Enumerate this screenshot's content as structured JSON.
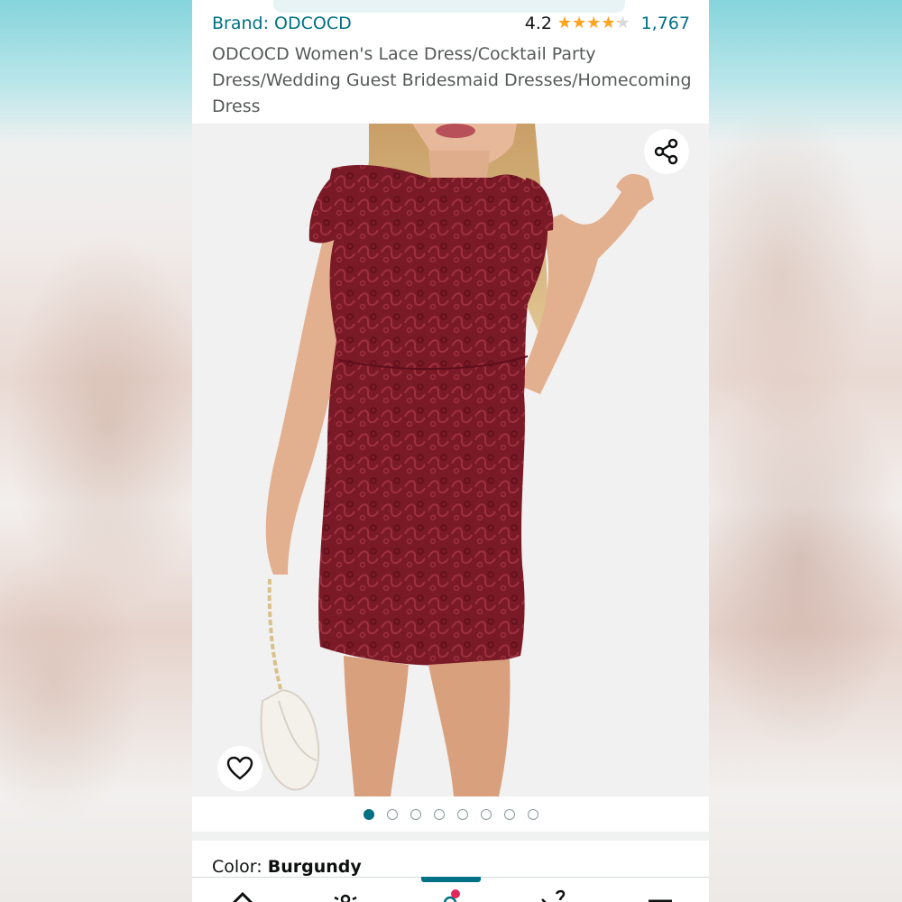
{
  "product": {
    "brand_label": "Brand: ODCOCD",
    "rating_value": "4.2",
    "rating_out_of_5": 4.2,
    "rating_count": "1,767",
    "title": "ODCOCD Women's Lace Dress/Cocktail Party Dress/Wedding Guest Bridesmaid Dresses/Homecoming Dress"
  },
  "gallery": {
    "image_count": 8,
    "active_index": 0
  },
  "variation": {
    "color_label": "Color: ",
    "color_value": "Burgundy"
  },
  "icons": {
    "share": "share-icon",
    "wishlist": "heart-icon",
    "nav": [
      "home-icon",
      "profile-icon",
      "cart-icon",
      "menu-icon"
    ]
  },
  "colors": {
    "accent": "#007185",
    "star": "#ffa41c",
    "dress": "#7a1a26",
    "cart_badge": "#e3265e"
  }
}
